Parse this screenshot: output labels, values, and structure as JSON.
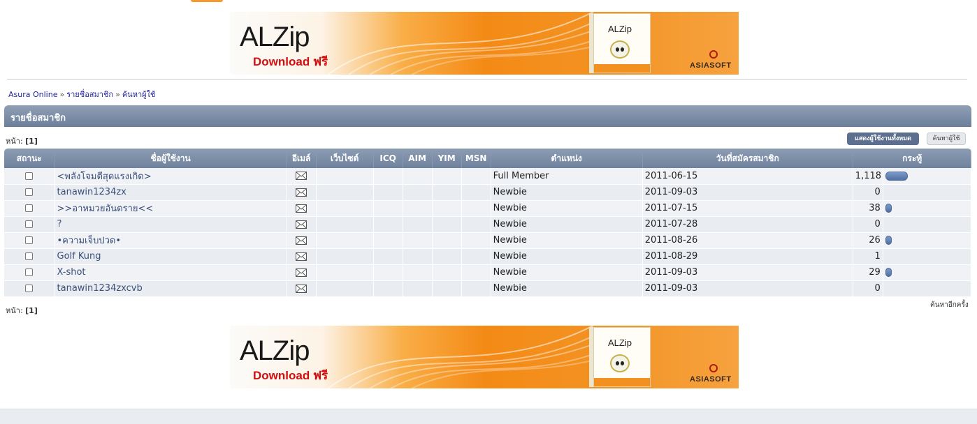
{
  "banner": {
    "title": "ALZip",
    "download": "Download ฟรี",
    "box_title": "ALZip",
    "brand": "ASIASOFT",
    "colors": {
      "orange": "#f48a16",
      "red": "#d01010"
    }
  },
  "breadcrumb": {
    "items": [
      "Asura Online",
      "รายชื่อสมาชิก",
      "ค้นหาผู้ใช้"
    ],
    "separator": "»"
  },
  "section": {
    "title": "รายชื่อสมาชิก"
  },
  "pager": {
    "label": "หน้า:",
    "page": "[1]"
  },
  "buttons": {
    "show_all": "แสดงผู้ใช้งานทั้งหมด",
    "search": "ค้นหาผู้ใช้"
  },
  "search_again": "ค้นหาอีกครั้ง",
  "table": {
    "headers": [
      "สถานะ",
      "ชื่อผู้ใช้งาน",
      "อีเมล์",
      "เว็บไซต์",
      "ICQ",
      "AIM",
      "YIM",
      "MSN",
      "ตำแหน่ง",
      "วันที่สมัครสมาชิก",
      "กระทู้"
    ],
    "rows": [
      {
        "name": "<พลังโจมตีสุดแรงเกิด>",
        "rank": "Full Member",
        "date": "2011-06-15",
        "posts": "1,118",
        "bar": 1.0
      },
      {
        "name": "tanawin1234zx",
        "rank": "Newbie",
        "date": "2011-09-03",
        "posts": "0",
        "bar": 0
      },
      {
        "name": ">>อาหมวยอันตราย<<",
        "rank": "Newbie",
        "date": "2011-07-15",
        "posts": "38",
        "bar": 0.2
      },
      {
        "name": "?",
        "rank": "Newbie",
        "date": "2011-07-28",
        "posts": "0",
        "bar": 0
      },
      {
        "name": "•ความเจ็บปวด•",
        "rank": "Newbie",
        "date": "2011-08-26",
        "posts": "26",
        "bar": 0.2
      },
      {
        "name": "Golf Kung",
        "rank": "Newbie",
        "date": "2011-08-29",
        "posts": "1",
        "bar": 0
      },
      {
        "name": "X-shot",
        "rank": "Newbie",
        "date": "2011-09-03",
        "posts": "29",
        "bar": 0.2
      },
      {
        "name": "tanawin1234zxcvb",
        "rank": "Newbie",
        "date": "2011-09-03",
        "posts": "0",
        "bar": 0
      }
    ]
  }
}
